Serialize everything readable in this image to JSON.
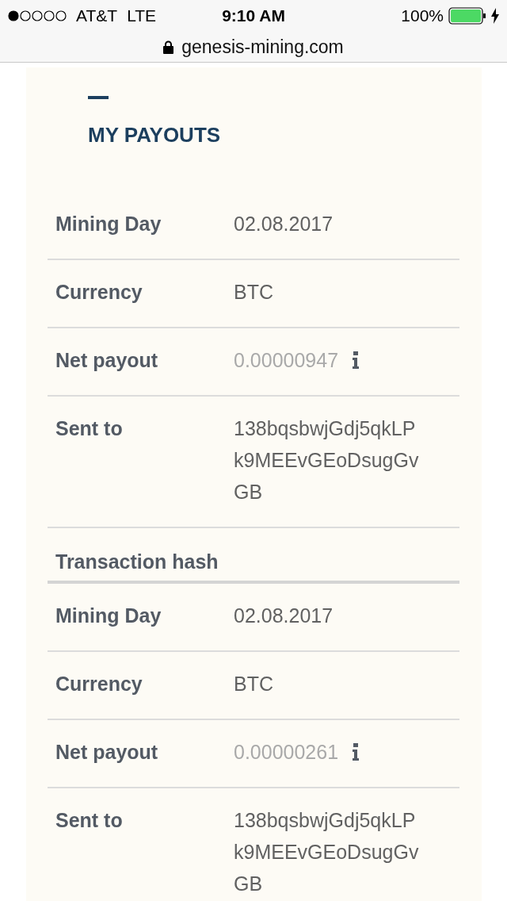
{
  "status_bar": {
    "carrier": "AT&T",
    "network": "LTE",
    "time": "9:10 AM",
    "battery": "100%"
  },
  "address_bar": {
    "domain": "genesis-mining.com",
    "secure": true
  },
  "section": {
    "title": "MY PAYOUTS"
  },
  "payouts": [
    {
      "rows": [
        {
          "kind": "text",
          "label": "Mining Day",
          "value": "02.08.2017"
        },
        {
          "kind": "text",
          "label": "Currency",
          "value": "BTC"
        },
        {
          "kind": "amount",
          "label": "Net payout",
          "value": "0.00000947"
        },
        {
          "kind": "address",
          "label": "Sent to",
          "value": "138bqsbwjGdj5qkLPk9MEEvGEoDsugGvGB"
        }
      ],
      "footer": "Transaction hash"
    },
    {
      "rows": [
        {
          "kind": "text",
          "label": "Mining Day",
          "value": "02.08.2017"
        },
        {
          "kind": "text",
          "label": "Currency",
          "value": "BTC"
        },
        {
          "kind": "amount",
          "label": "Net payout",
          "value": "0.00000261"
        },
        {
          "kind": "address",
          "label": "Sent to",
          "value": "138bqsbwjGdj5qkLPk9MEEvGEoDsugGvGB"
        }
      ]
    }
  ]
}
